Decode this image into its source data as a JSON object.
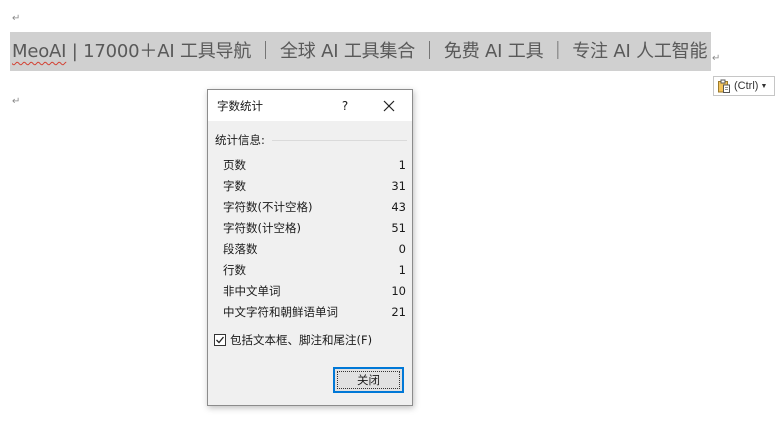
{
  "document": {
    "line_text_prefix": " | 17000＋AI 工具导航 ｜ 全球 AI 工具集合 ｜ 免费 AI 工具 ｜ 专注 AI 人工智能",
    "misspelled_word": "MeoAI",
    "paragraph_mark": "↵"
  },
  "paste_options": {
    "label": "(Ctrl)",
    "icon": "clipboard-icon"
  },
  "dialog": {
    "title": "字数统计",
    "help_label": "?",
    "close_icon": "close-icon",
    "section_label": "统计信息:",
    "stats": [
      {
        "label": "页数",
        "value": "1"
      },
      {
        "label": "字数",
        "value": "31"
      },
      {
        "label": "字符数(不计空格)",
        "value": "43"
      },
      {
        "label": "字符数(计空格)",
        "value": "51"
      },
      {
        "label": "段落数",
        "value": "0"
      },
      {
        "label": "行数",
        "value": "1"
      },
      {
        "label": "非中文单词",
        "value": "10"
      },
      {
        "label": "中文字符和朝鲜语单词",
        "value": "21"
      }
    ],
    "checkbox_label": "包括文本框、脚注和尾注(F)",
    "checkbox_checked": true,
    "close_button_label": "关闭"
  }
}
